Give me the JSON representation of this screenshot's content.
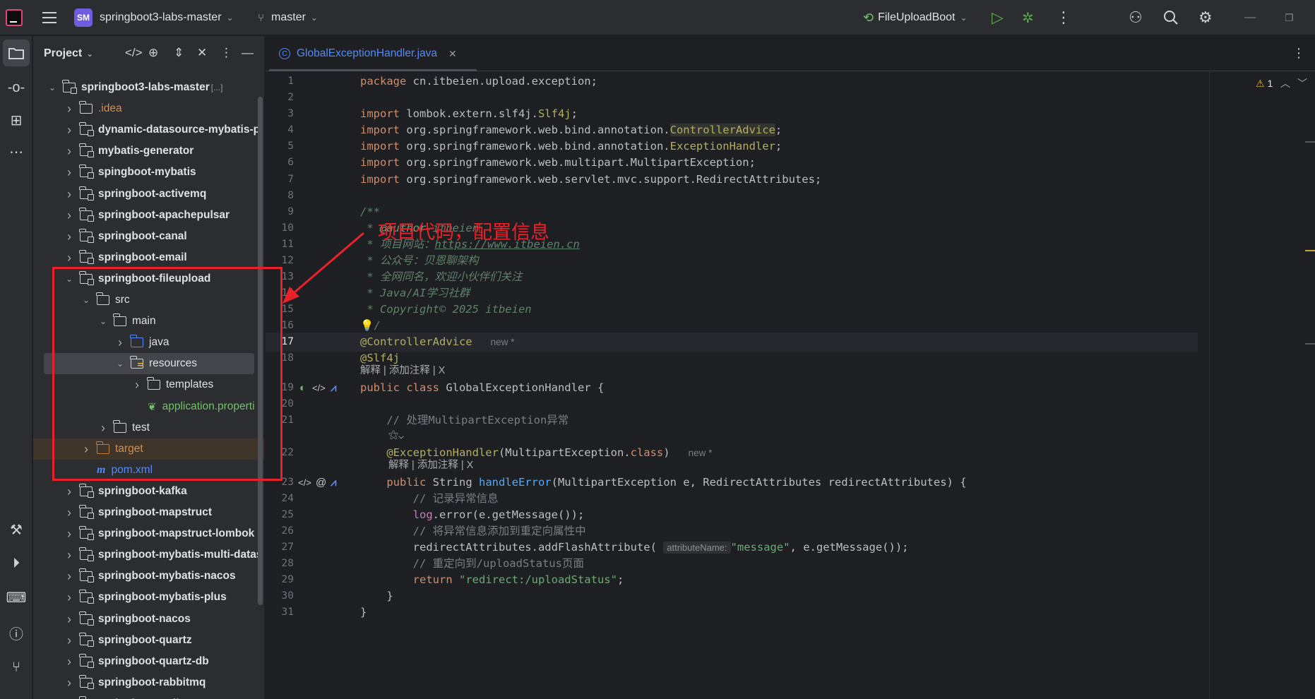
{
  "titlebar": {
    "project_badge": "SM",
    "project_name": "springboot3-labs-master",
    "branch": "master",
    "run_config": "FileUploadBoot"
  },
  "project_panel": {
    "title": "Project",
    "tree": [
      {
        "label": "springboot3-labs-master",
        "extra": "[...]",
        "level": 0,
        "expanded": true,
        "kind": "module",
        "bold": true
      },
      {
        "label": ".idea",
        "level": 1,
        "expanded": false,
        "kind": "folder",
        "color": "orange"
      },
      {
        "label": "dynamic-datasource-mybatis-p",
        "level": 1,
        "expanded": false,
        "kind": "module",
        "bold": true
      },
      {
        "label": "mybatis-generator",
        "level": 1,
        "expanded": false,
        "kind": "module",
        "bold": true
      },
      {
        "label": "spingboot-mybatis",
        "level": 1,
        "expanded": false,
        "kind": "module",
        "bold": true
      },
      {
        "label": "springboot-activemq",
        "level": 1,
        "expanded": false,
        "kind": "module",
        "bold": true
      },
      {
        "label": "springboot-apachepulsar",
        "level": 1,
        "expanded": false,
        "kind": "module",
        "bold": true
      },
      {
        "label": "springboot-canal",
        "level": 1,
        "expanded": false,
        "kind": "module",
        "bold": true
      },
      {
        "label": "springboot-email",
        "level": 1,
        "expanded": false,
        "kind": "module",
        "bold": true
      },
      {
        "label": "springboot-fileupload",
        "level": 1,
        "expanded": true,
        "kind": "module",
        "bold": true
      },
      {
        "label": "src",
        "level": 2,
        "expanded": true,
        "kind": "folder"
      },
      {
        "label": "main",
        "level": 3,
        "expanded": true,
        "kind": "folder"
      },
      {
        "label": "java",
        "level": 4,
        "expanded": false,
        "kind": "folder-blue"
      },
      {
        "label": "resources",
        "level": 4,
        "expanded": true,
        "kind": "folder-res",
        "selected": true
      },
      {
        "label": "templates",
        "level": 5,
        "expanded": false,
        "kind": "folder"
      },
      {
        "label": "application.properti",
        "level": 5,
        "kind": "properties",
        "color": "green"
      },
      {
        "label": "test",
        "level": 3,
        "expanded": false,
        "kind": "folder"
      },
      {
        "label": "target",
        "level": 2,
        "expanded": false,
        "kind": "folder-orange",
        "color": "orange",
        "excluded": true
      },
      {
        "label": "pom.xml",
        "level": 2,
        "kind": "maven",
        "color": "blue"
      },
      {
        "label": "springboot-kafka",
        "level": 1,
        "expanded": false,
        "kind": "module",
        "bold": true
      },
      {
        "label": "springboot-mapstruct",
        "level": 1,
        "expanded": false,
        "kind": "module",
        "bold": true
      },
      {
        "label": "springboot-mapstruct-lombok",
        "level": 1,
        "expanded": false,
        "kind": "module",
        "bold": true
      },
      {
        "label": "springboot-mybatis-multi-datas",
        "level": 1,
        "expanded": false,
        "kind": "module",
        "bold": true
      },
      {
        "label": "springboot-mybatis-nacos",
        "level": 1,
        "expanded": false,
        "kind": "module",
        "bold": true
      },
      {
        "label": "springboot-mybatis-plus",
        "level": 1,
        "expanded": false,
        "kind": "module",
        "bold": true
      },
      {
        "label": "springboot-nacos",
        "level": 1,
        "expanded": false,
        "kind": "module",
        "bold": true
      },
      {
        "label": "springboot-quartz",
        "level": 1,
        "expanded": false,
        "kind": "module",
        "bold": true
      },
      {
        "label": "springboot-quartz-db",
        "level": 1,
        "expanded": false,
        "kind": "module",
        "bold": true
      },
      {
        "label": "springboot-rabbitmq",
        "level": 1,
        "expanded": false,
        "kind": "module",
        "bold": true
      },
      {
        "label": "springboot-redis",
        "level": 1,
        "expanded": false,
        "kind": "module",
        "bold": true
      }
    ]
  },
  "editor": {
    "tab": {
      "name": "GlobalExceptionHandler.java",
      "icon": "class-icon"
    },
    "warnings": "1",
    "inlay_actions": "解释 | 添加注释 | X",
    "new_marker": "new *",
    "param_hint": "attributeName:"
  },
  "annotation": {
    "text": "项目代码，配置信息",
    "color": "#e8212a"
  },
  "colors": {
    "background": "#1e1f22",
    "panel": "#2b2d30",
    "keyword": "#cf8e6d",
    "annotation": "#b3ae60",
    "string": "#6aab73",
    "function": "#56a8f5",
    "comment": "#7a7e85",
    "doc_comment": "#5f826b"
  }
}
